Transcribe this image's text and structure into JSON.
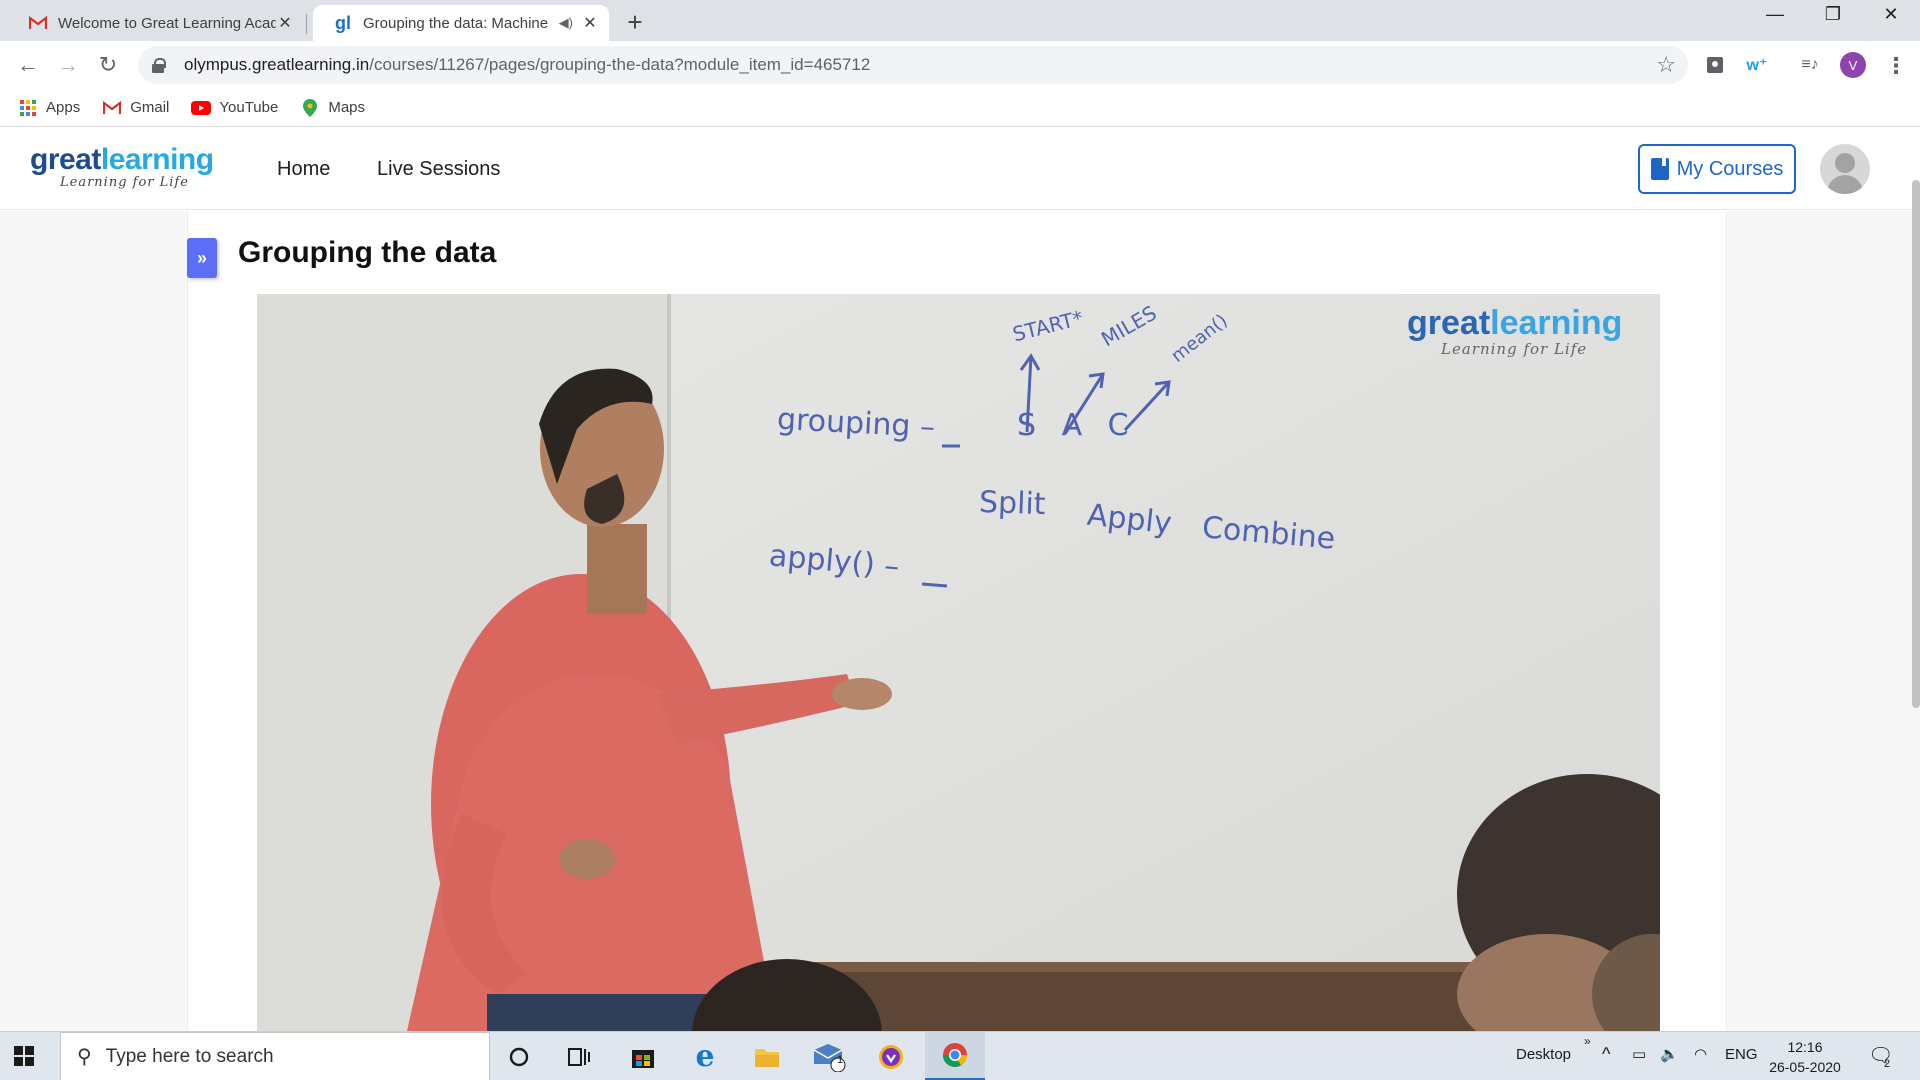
{
  "browser": {
    "tabs": [
      {
        "title": "Welcome to Great Learning Acad",
        "favicon": "gmail-icon",
        "active": false
      },
      {
        "title": "Grouping the data: Machine",
        "favicon": "greatlearning-icon",
        "active": true
      }
    ],
    "address": {
      "domain": "olympus.greatlearning.in",
      "path": "/courses/11267/pages/grouping-the-data?module_item_id=465712"
    },
    "profile_initial": "V",
    "bookmarks": [
      {
        "label": "Apps",
        "icon": "apps-grid-icon"
      },
      {
        "label": "Gmail",
        "icon": "gmail-icon"
      },
      {
        "label": "YouTube",
        "icon": "youtube-icon"
      },
      {
        "label": "Maps",
        "icon": "maps-pin-icon"
      }
    ]
  },
  "site": {
    "logo": {
      "word_a": "great",
      "word_b": "learning",
      "tagline": "Learning for Life"
    },
    "nav": {
      "home": "Home",
      "live_sessions": "Live Sessions"
    },
    "my_courses": "My Courses"
  },
  "page": {
    "title": "Grouping the data",
    "expand_glyph": "»",
    "video": {
      "watermark": {
        "word_a": "great",
        "word_b": "learning",
        "tagline": "Learning for Life"
      },
      "whiteboard": {
        "grouping": "grouping –",
        "letters": "S A C",
        "start": "START*",
        "miles": "MILES",
        "mean": "mean()",
        "split": "Split",
        "apply_word": "Apply",
        "combine": "Combine",
        "apply_fn": "apply() –"
      }
    }
  },
  "taskbar": {
    "search_placeholder": "Type here to search",
    "desktop_label": "Desktop",
    "language": "ENG",
    "time": "12:16",
    "date": "26-05-2020",
    "mail_badge": "1",
    "notification_count": "2"
  },
  "colors": {
    "accent_blue": "#1f66c9",
    "logo_dark": "#1e4b8f",
    "logo_light": "#25a9e0",
    "expand_button": "#5b6ef5",
    "marker_ink": "#4f63b0"
  }
}
